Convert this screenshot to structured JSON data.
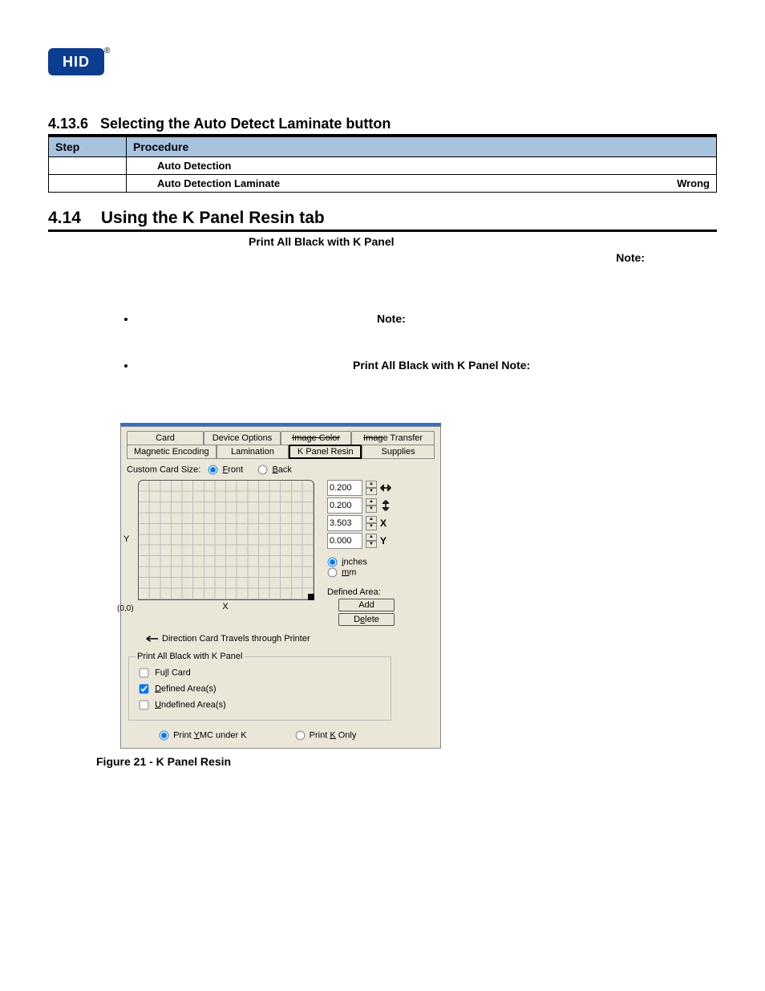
{
  "logo_text": "HID",
  "reg_mark": "®",
  "section1": {
    "number": "4.13.6",
    "title": "Selecting the Auto Detect Laminate button"
  },
  "table": {
    "header_step": "Step",
    "header_proc": "Procedure",
    "row1_text": "Auto Detection",
    "row2_left": "Auto Detection Laminate",
    "row2_right": "Wrong"
  },
  "section2": {
    "number": "4.14",
    "title": "Using the K Panel Resin tab"
  },
  "subtitle_bold": "Print All Black with K Panel",
  "note_label": "Note:",
  "mid_note_label": "Note:",
  "bullet2_text": "Print All Black with K Panel   Note:",
  "caption": "Figure 21 - K Panel Resin",
  "dialog": {
    "tabs_row1": [
      "Card",
      "Device Options",
      "Image Color",
      "Image Transfer"
    ],
    "tabs_row2": [
      "Magnetic Encoding",
      "Lamination",
      "K Panel Resin",
      "Supplies"
    ],
    "custom_label": "Custom Card Size:",
    "front_label_pre": "F",
    "front_label_rest": "ront",
    "back_label_pre": "B",
    "back_label_rest": "ack",
    "y_label": "Y",
    "origin": "(0,0)",
    "x_label": "X",
    "spin": {
      "w": "0.200",
      "h": "0.200",
      "x": "3.503",
      "y": "0.000",
      "X": "X",
      "Y": "Y"
    },
    "unit_inches_pre": "i",
    "unit_inches_rest": "nches",
    "unit_mm_pre": "m",
    "unit_mm_rest": "m",
    "defined_area_label": "Defined Area:",
    "add_btn": "Add",
    "delete_btn_pre": "D",
    "delete_btn_rest": "elete",
    "direction_text": "Direction Card Travels through Printer",
    "group_title": "Print All Black with K Panel",
    "full_card_pre": "Fu",
    "full_card_ul": "l",
    "full_card_rest": "l Card",
    "defined_areas_pre": "D",
    "defined_areas_rest": "efined Area(s)",
    "undefined_areas_pre": "U",
    "undefined_areas_rest": "ndefined Area(s)",
    "pr_ymc_pre": "Print ",
    "pr_ymc_ul": "Y",
    "pr_ymc_rest": "MC under K",
    "pr_k_pre": "Print ",
    "pr_k_ul": "K",
    "pr_k_rest": " Only"
  }
}
